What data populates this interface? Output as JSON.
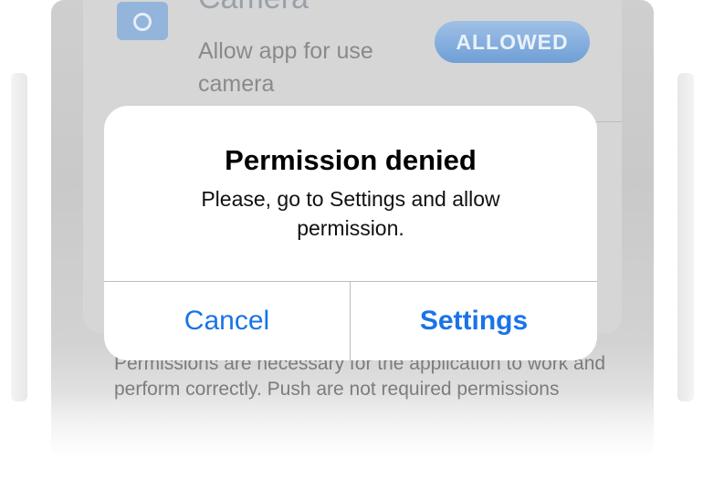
{
  "background": {
    "permission_title": "Camera",
    "permission_description": "Allow app for use camera",
    "status_button": "ALLOWED",
    "footnote": "Permissions are necessary for the application to work and perform correctly. Push are not required permissions"
  },
  "alert": {
    "title": "Permission denied",
    "message": "Please, go to Settings and allow permission.",
    "cancel_label": "Cancel",
    "settings_label": "Settings"
  },
  "colors": {
    "accent": "#1a73e8",
    "dim_overlay": "#c9c9c9",
    "allowed_button": "#6f9fd6"
  },
  "icons": {
    "permission_icon": "camera-icon"
  }
}
